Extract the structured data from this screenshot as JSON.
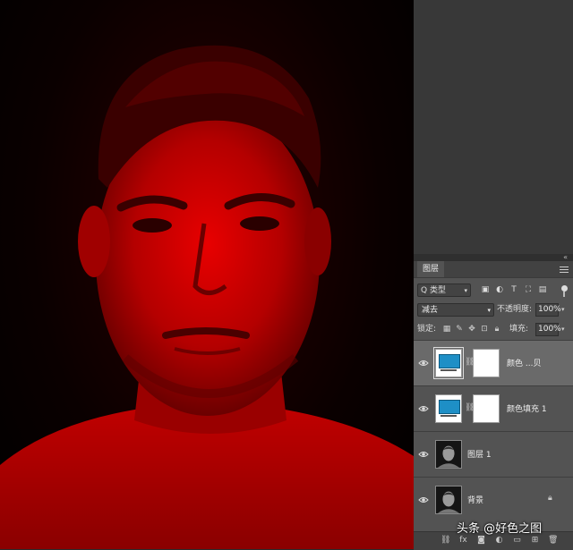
{
  "canvas": {
    "subject": "portrait-red-tint"
  },
  "layers_panel": {
    "tab_title": "图层",
    "filter_label": "Q 类型",
    "blend_mode": "减去",
    "opacity_label": "不透明度:",
    "opacity_value": "100%",
    "lock_label": "锁定:",
    "fill_label": "填充:",
    "fill_value": "100%",
    "layers": [
      {
        "name": "颜色 ...贝",
        "type": "fill-adjustment",
        "selected": true
      },
      {
        "name": "颜色填充 1",
        "type": "fill-adjustment",
        "selected": false
      },
      {
        "name": "图层 1",
        "type": "pixel",
        "selected": false
      },
      {
        "name": "背景",
        "type": "background",
        "locked": true
      }
    ],
    "bottom_icons": [
      "link-icon",
      "fx-icon",
      "mask-icon",
      "adjustment-icon",
      "group-icon",
      "new-layer-icon",
      "trash-icon"
    ],
    "bottom_fx_label": "fx"
  },
  "colors": {
    "fill_swatch": "#1e8fc6",
    "canvas_tint": "#d40000"
  },
  "watermark": {
    "text": "头条 @好色之图"
  }
}
